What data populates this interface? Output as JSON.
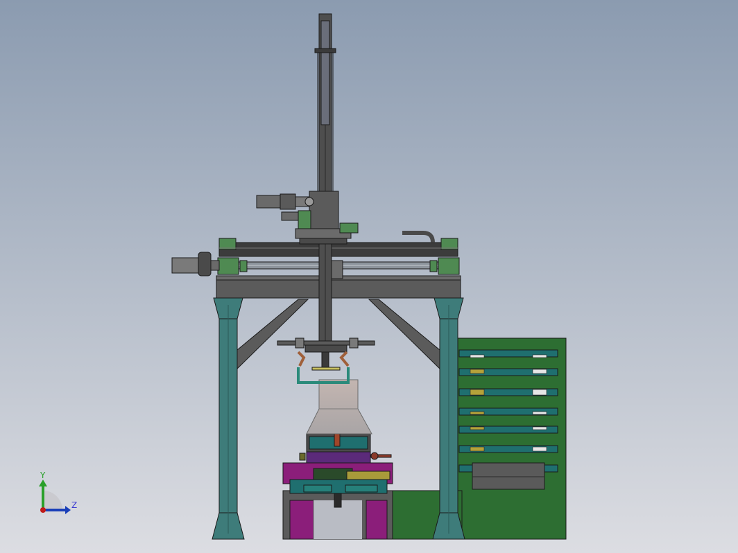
{
  "colors": {
    "bg_top": "#8b9bb0",
    "bg_bottom": "#dcdde2",
    "frame_teal": "#3e7c7a",
    "frame_gray": "#5b5b5b",
    "dark_gray": "#3c3c3c",
    "green_cabinet": "#2d6e32",
    "magenta": "#8b1e7a",
    "cone": "#b8a9a4",
    "motor_green": "#4f8a52",
    "axis_y": "#2aa02a",
    "axis_z": "#1a3fb8",
    "axis_x": "#c01a1a",
    "axis_label": "#3b3bd1"
  },
  "axes": {
    "y_label": "Y",
    "z_label": "Z"
  }
}
